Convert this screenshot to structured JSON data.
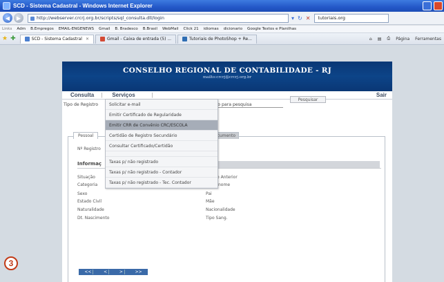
{
  "window": {
    "title": "SCD - Sistema Cadastral - Windows Internet Explorer"
  },
  "addressbar": {
    "url": "http://webserver.crcrj.org.br/scripts/sql_consulta.dll/login",
    "search_value": "tutoriais.org"
  },
  "links": [
    "Links",
    "Adm",
    "B.Empregos",
    "EMAIL-ENGENEWS",
    "Gmail",
    "B. Bradesco",
    "B.Brasil",
    "WebMail",
    "Click 21",
    "idiomas",
    "dicionario",
    "Google Textos e Planilhas"
  ],
  "tabs": [
    {
      "label": "SCD - Sistema Cadastral"
    },
    {
      "label": "Gmail - Caixa de entrada (5) ..."
    },
    {
      "label": "Tutoriais de PhotoShop + Re..."
    }
  ],
  "command_bar": {
    "page": "Página",
    "tools": "Ferramentas"
  },
  "site": {
    "title": "CONSELHO REGIONAL DE CONTABILIDADE - RJ",
    "email": "mailto:crcrj@crcrj.org.br",
    "menu": {
      "consulta": "Consulta",
      "servicos": "Serviços",
      "sair": "Sair"
    },
    "tipo_registro": "Tipo de Registro",
    "conteudo": "conteúdo para pesquisa",
    "pesquisar": "Pesquisar",
    "tabs": {
      "pessoal": "Pessoal",
      "documento": "Documento"
    },
    "registro": "Nº Registro",
    "informacoes": "Informaç",
    "fields_left": [
      "Situação",
      "Categoria",
      "Sexo",
      "Estado Civil",
      "Naturalidade",
      "Dt. Nascimento"
    ],
    "fields_right": [
      "o Anterior",
      "nome",
      "Pai",
      "Mãe",
      "Nacionalidade",
      "Tipo Sang."
    ],
    "pager": [
      "<<",
      "<",
      ">",
      ">>"
    ]
  },
  "dropdown": {
    "items": [
      "Solicitar e-mail",
      "Emitir Certificado de Regularidade",
      "Emitir CRR de Convênio CRC/ESCOLA",
      "Certidão de Registro Secundário",
      "Consultar Certificado/Certidão",
      "Taxas p/ não registrado",
      "Taxas p/ não registrado - Contador",
      "Taxas p/ não registrado - Tec. Contador"
    ],
    "highlighted_index": 2
  },
  "badge": "3"
}
